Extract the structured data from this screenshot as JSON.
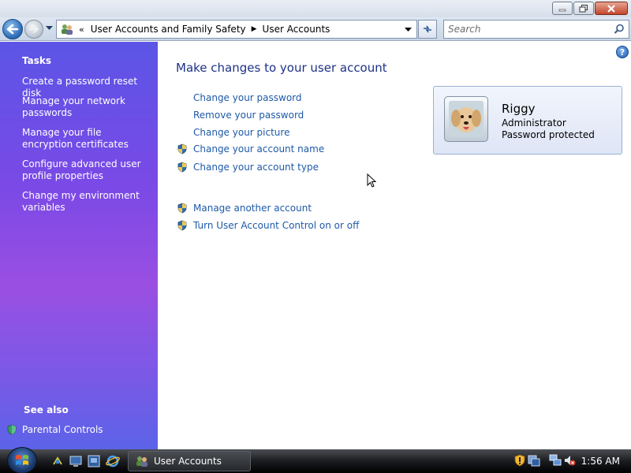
{
  "address": {
    "crumbs": [
      "User Accounts and Family Safety",
      "User Accounts"
    ]
  },
  "search": {
    "placeholder": "Search"
  },
  "left_pane": {
    "tasks_heading": "Tasks",
    "tasks": [
      "Create a password reset disk",
      "Manage your network passwords",
      "Manage your file encryption certificates",
      "Configure advanced user profile properties",
      "Change my environment variables"
    ],
    "see_also_heading": "See also",
    "see_also": [
      "Parental Controls"
    ]
  },
  "main": {
    "title": "Make changes to your user account",
    "actions": [
      {
        "label": "Change your password",
        "shield": false
      },
      {
        "label": "Remove your password",
        "shield": false
      },
      {
        "label": "Change your picture",
        "shield": false
      },
      {
        "label": "Change your account name",
        "shield": true
      },
      {
        "label": "Change your account type",
        "shield": true
      },
      {
        "label": "Manage another account",
        "shield": true
      },
      {
        "label": "Turn User Account Control on or off",
        "shield": true
      }
    ]
  },
  "account": {
    "name": "Riggy",
    "type": "Administrator",
    "status": "Password protected"
  },
  "taskbar": {
    "window_label": "User Accounts",
    "clock": "1:56 AM"
  },
  "colors": {
    "link": "#1e59a8",
    "title": "#1e3287",
    "left_pane_top": "#5b55e6",
    "left_pane_mid": "#9a4fe2"
  }
}
